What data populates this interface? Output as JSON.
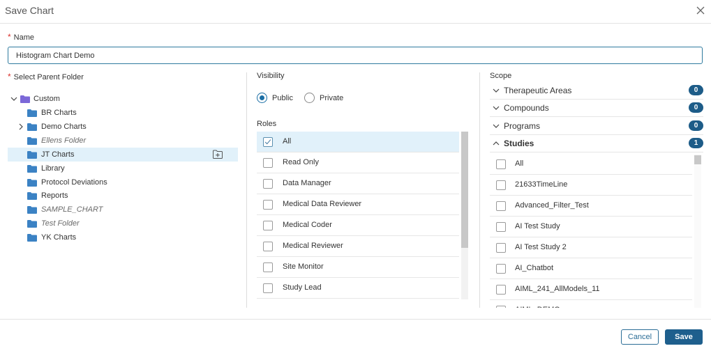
{
  "dialog": {
    "title": "Save Chart"
  },
  "name_field": {
    "label": "Name",
    "required_mark": "*",
    "value": "Histogram Chart Demo"
  },
  "folder": {
    "label": "Select Parent Folder",
    "required_mark": "*",
    "root": "Custom",
    "items": [
      {
        "label": "BR Charts",
        "italic": false
      },
      {
        "label": "Demo Charts",
        "italic": false
      },
      {
        "label": "Ellens Folder",
        "italic": true
      },
      {
        "label": "JT Charts",
        "italic": false,
        "selected": true
      },
      {
        "label": "Library",
        "italic": false
      },
      {
        "label": "Protocol Deviations",
        "italic": false
      },
      {
        "label": "Reports",
        "italic": false
      },
      {
        "label": "SAMPLE_CHART",
        "italic": true
      },
      {
        "label": "Test Folder",
        "italic": true
      },
      {
        "label": "YK Charts",
        "italic": false
      }
    ]
  },
  "visibility": {
    "label": "Visibility",
    "options": [
      {
        "label": "Public",
        "checked": true
      },
      {
        "label": "Private",
        "checked": false
      }
    ]
  },
  "roles": {
    "label": "Roles",
    "items": [
      {
        "label": "All",
        "checked": true
      },
      {
        "label": "Read Only",
        "checked": false
      },
      {
        "label": "Data Manager",
        "checked": false
      },
      {
        "label": "Medical Data Reviewer",
        "checked": false
      },
      {
        "label": "Medical Coder",
        "checked": false
      },
      {
        "label": "Medical Reviewer",
        "checked": false
      },
      {
        "label": "Site Monitor",
        "checked": false
      },
      {
        "label": "Study Lead",
        "checked": false
      }
    ]
  },
  "scope": {
    "label": "Scope",
    "groups": [
      {
        "label": "Therapeutic Areas",
        "count": "0",
        "expanded": false
      },
      {
        "label": "Compounds",
        "count": "0",
        "expanded": false
      },
      {
        "label": "Programs",
        "count": "0",
        "expanded": false
      },
      {
        "label": "Studies",
        "count": "1",
        "expanded": true
      }
    ],
    "studies": [
      "All",
      "21633TimeLine",
      "Advanced_Filter_Test",
      "AI Test Study",
      "AI Test Study 2",
      "AI_Chatbot",
      "AIML_241_AllModels_11",
      "AIML_DEMO"
    ]
  },
  "footer": {
    "cancel_label": "Cancel",
    "save_label": "Save"
  },
  "colors": {
    "accent": "#1e5f8d",
    "folder": "#3b82c4",
    "root_folder": "#7b68d8",
    "selected_bg": "#e1f1fa"
  }
}
